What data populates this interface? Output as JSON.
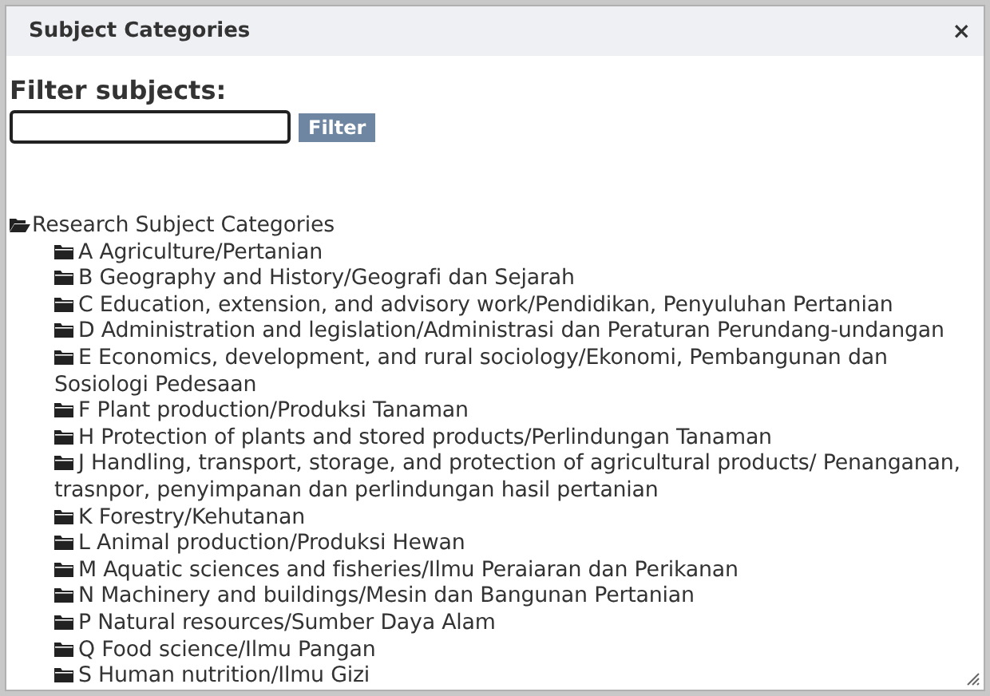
{
  "window": {
    "title": "Subject Categories",
    "close": "×"
  },
  "filter": {
    "heading": "Filter subjects:",
    "button": "Filter"
  },
  "tree": {
    "label": "Research Subject Categories",
    "expanded": true,
    "children": [
      {
        "label": "A Agriculture/Pertanian",
        "expanded": false
      },
      {
        "label": "B Geography and History/Geografi dan Sejarah",
        "expanded": false
      },
      {
        "label": "C Education, extension, and advisory work/Pendidikan, Penyuluhan Pertanian",
        "expanded": false
      },
      {
        "label": "D Administration and legislation/Administrasi dan Peraturan Perundang-undangan",
        "expanded": false
      },
      {
        "label": "E Economics, development, and rural sociology/Ekonomi, Pembangunan dan Sosiologi Pedesaan",
        "expanded": false
      },
      {
        "label": "F Plant production/Produksi Tanaman",
        "expanded": false
      },
      {
        "label": "H Protection of plants and stored products/Perlindungan Tanaman",
        "expanded": false
      },
      {
        "label": "J Handling, transport, storage, and protection of agricultural products/ Penanganan, trasnpor, penyimpanan dan perlindungan hasil pertanian",
        "expanded": false
      },
      {
        "label": "K Forestry/Kehutanan",
        "expanded": false
      },
      {
        "label": "L Animal production/Produksi Hewan",
        "expanded": false
      },
      {
        "label": "M Aquatic sciences and fisheries/Ilmu Peraiaran dan Perikanan",
        "expanded": false
      },
      {
        "label": "N Machinery and buildings/Mesin dan Bangunan Pertanian",
        "expanded": false
      },
      {
        "label": "P Natural resources/Sumber Daya Alam",
        "expanded": false
      },
      {
        "label": "Q Food science/Ilmu Pangan",
        "expanded": false
      },
      {
        "label": "S Human nutrition/Ilmu Gizi",
        "expanded": false
      }
    ]
  }
}
